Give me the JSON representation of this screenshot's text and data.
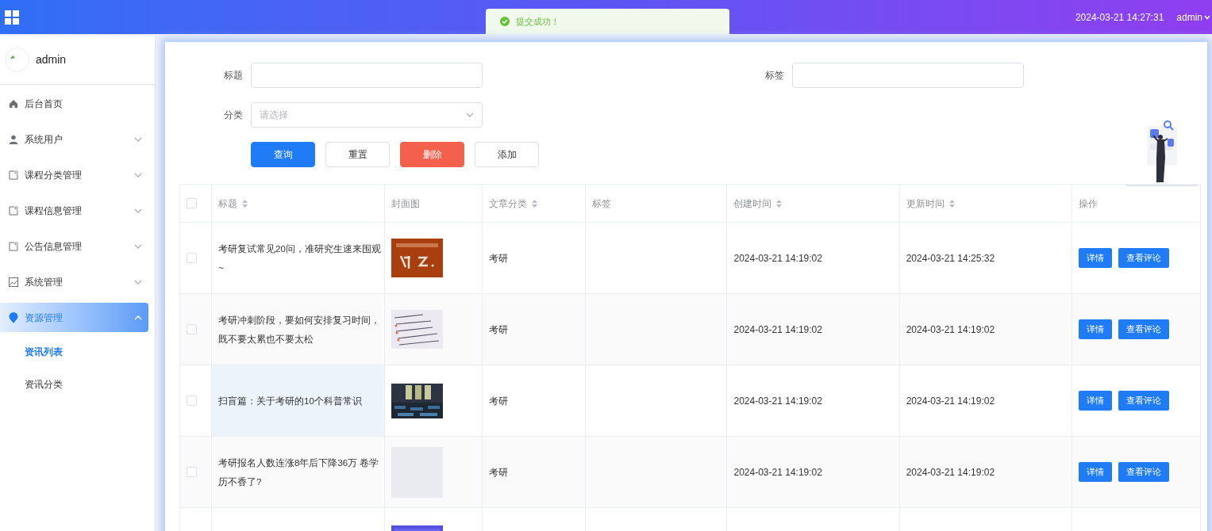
{
  "header": {
    "datetime": "2024-03-21 14:27:31",
    "user": "admin"
  },
  "toast": {
    "message": "提交成功！"
  },
  "sidebar": {
    "user": "admin",
    "items": [
      {
        "label": "后台首页",
        "selected": false
      },
      {
        "label": "系统用户",
        "expanded": false,
        "selected": false
      },
      {
        "label": "课程分类管理",
        "expanded": false,
        "selected": false
      },
      {
        "label": "课程信息管理",
        "expanded": false,
        "selected": false
      },
      {
        "label": "公告信息管理",
        "expanded": false,
        "selected": false
      },
      {
        "label": "系统管理",
        "expanded": false,
        "selected": false
      },
      {
        "label": "资源管理",
        "expanded": true,
        "selected": true,
        "children": [
          {
            "label": "资讯列表",
            "selected": true
          },
          {
            "label": "资讯分类",
            "selected": false
          }
        ]
      }
    ]
  },
  "filters": [
    {
      "label": "标题",
      "kind": "input"
    },
    {
      "label": "标签",
      "kind": "input"
    },
    {
      "label": "分类",
      "kind": "select",
      "placeholder": "请选择"
    }
  ],
  "actions": [
    {
      "label": "查询",
      "kind": "primary"
    },
    {
      "label": "重置",
      "kind": "plain"
    },
    {
      "label": "删除",
      "kind": "danger"
    },
    {
      "label": "添加",
      "kind": "plain"
    }
  ],
  "table": {
    "all_checked": false,
    "columns": [
      {
        "label": "标题",
        "sortable": true
      },
      {
        "label": "封面图",
        "sortable": false
      },
      {
        "label": "文章分类",
        "sortable": true
      },
      {
        "label": "标签",
        "sortable": false
      },
      {
        "label": "创建时间",
        "sortable": true
      },
      {
        "label": "更新时间",
        "sortable": true
      },
      {
        "label": "操作",
        "sortable": false
      }
    ],
    "rows": [
      {
        "checked": false,
        "title": "考研复试常见20问，准研究生速来围观~",
        "title_hovered": false,
        "cover": {
          "kind": "picture"
        },
        "category": "考研",
        "created": "2024-03-21 14:19:02",
        "updated": "2024-03-21 14:25:32",
        "buttons": [
          "详情",
          "查看评论"
        ]
      },
      {
        "checked": false,
        "title": "考研冲刺阶段，要如何安排复习时间，既不要太累也不要太松",
        "title_hovered": false,
        "cover": {
          "kind": "picture"
        },
        "category": "考研",
        "created": "2024-03-21 14:19:02",
        "updated": "2024-03-21 14:19:02",
        "buttons": [
          "详情",
          "查看评论"
        ]
      },
      {
        "checked": false,
        "title": "扫盲篇：关于考研的10个科普常识",
        "title_hovered": true,
        "cover": {
          "kind": "picture"
        },
        "category": "考研",
        "created": "2024-03-21 14:19:02",
        "updated": "2024-03-21 14:19:02",
        "buttons": [
          "详情",
          "查看评论"
        ]
      },
      {
        "checked": false,
        "title": "考研报名人数连涨8年后下降36万 卷学历不香了?",
        "title_hovered": false,
        "cover": {
          "kind": "placeholder"
        },
        "category": "考研",
        "created": "2024-03-21 14:19:02",
        "updated": "2024-03-21 14:19:02",
        "buttons": [
          "详情",
          "查看评论"
        ]
      },
      {
        "cover": {
          "kind": "picture"
        }
      }
    ]
  }
}
